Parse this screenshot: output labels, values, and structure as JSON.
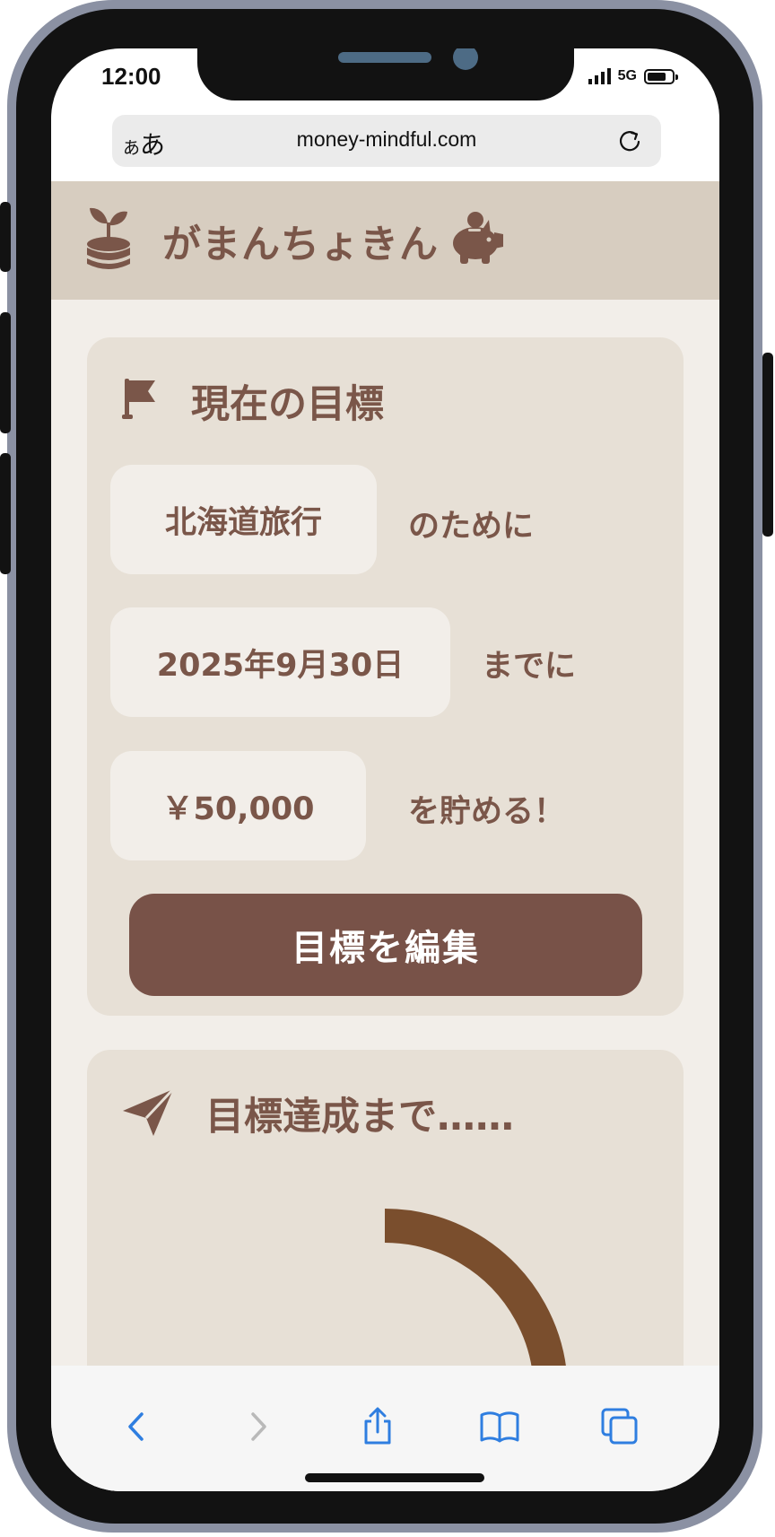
{
  "status_bar": {
    "time": "12:00",
    "network": "5G"
  },
  "browser": {
    "url": "money-mindful.com",
    "text_size_label_small": "あ",
    "text_size_label_large": "あ"
  },
  "app": {
    "title": "がまんちょきん"
  },
  "goal_card": {
    "title": "現在の目標",
    "purpose_value": "北海道旅行",
    "purpose_suffix": "のために",
    "date_value": "2025年9月30日",
    "date_suffix": "までに",
    "amount_value": "￥50,000",
    "amount_suffix": "を貯める！",
    "edit_button_label": "目標を編集"
  },
  "progress_card": {
    "title": "目標達成まで……"
  },
  "colors": {
    "brand_brown": "#7a5649",
    "button_brown": "#785248",
    "ring_brown": "#7a4e2d",
    "header_bg": "#d7cdc0",
    "card_bg": "#e7e0d6",
    "page_bg": "#f2eee9",
    "ios_blue": "#2f7ee0"
  },
  "icons": {
    "brand_logo": "coin-sprout-icon",
    "brand_mascot": "piggy-bank-icon",
    "goal_title": "flag-icon",
    "progress_title": "paper-plane-icon",
    "toolbar": [
      "back-icon",
      "forward-icon",
      "share-icon",
      "bookmarks-icon",
      "tabs-icon"
    ]
  }
}
